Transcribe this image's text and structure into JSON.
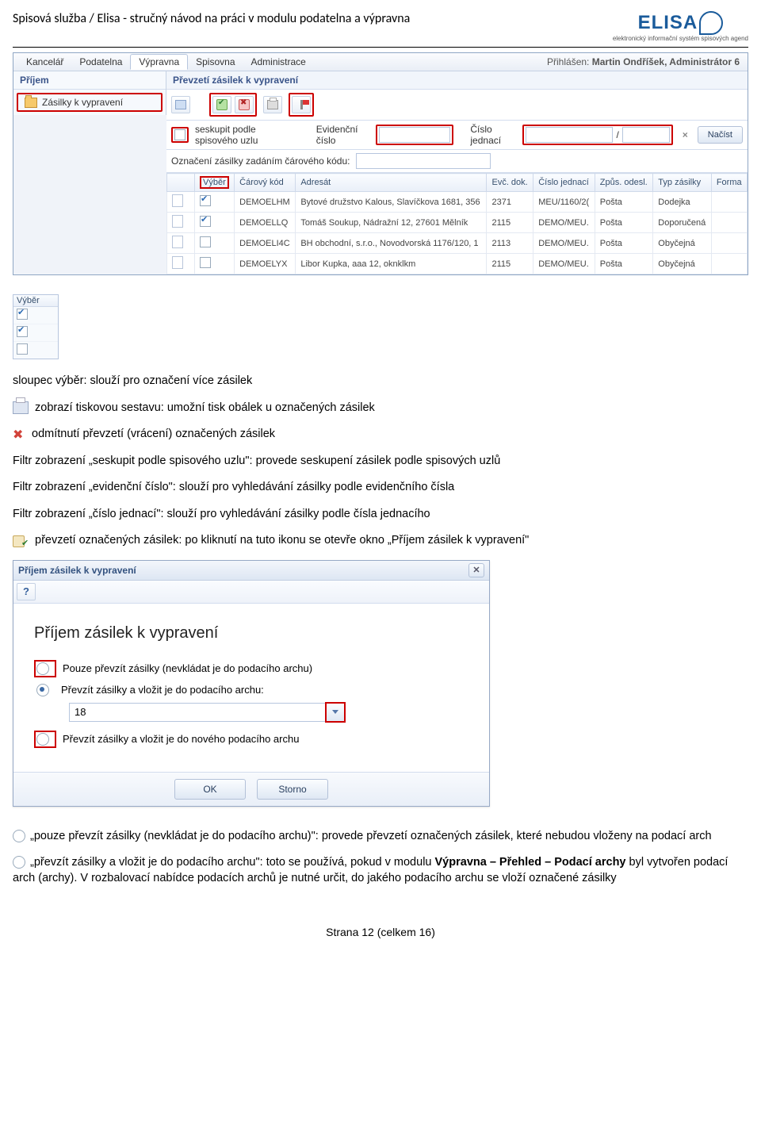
{
  "doc": {
    "title": "Spisová služba / Elisa - stručný návod na práci v modulu podatelna a výpravna",
    "page_footer": "Strana 12 (celkem 16)"
  },
  "logo": {
    "name": "ELISA",
    "tagline": "elektronický informační systém spisových agend"
  },
  "app": {
    "menu": {
      "kancelar": "Kancelář",
      "podatelna": "Podatelna",
      "vypravna": "Výpravna",
      "spisovna": "Spisovna",
      "admin": "Administrace"
    },
    "login_label": "Přihlášen:",
    "login_user": "Martin Ondříšek, Administrátor 6",
    "side_head": "Příjem",
    "side_item": "Zásilky k vypravení",
    "panel_title": "Převzetí zásilek k vypravení",
    "filters": {
      "group_label": "seskupit podle spisového uzlu",
      "ev_label": "Evidenční číslo",
      "cj_label": "Číslo jednací",
      "slash": "/",
      "load_btn": "Načíst"
    },
    "barcode_label": "Označení zásilky zadáním čárového kódu:",
    "columns": {
      "vyber": "Výběr",
      "carovy": "Čárový kód",
      "adresat": "Adresát",
      "evdok": "Evč. dok.",
      "cj": "Číslo jednací",
      "zpus": "Způs. odesl.",
      "typ": "Typ zásilky",
      "forma": "Forma"
    },
    "rows": [
      {
        "checked": true,
        "code": "DEMOELHM",
        "addr": "Bytové družstvo Kalous, Slavíčkova 1681, 356",
        "evdok": "2371",
        "cj": "MEU/1160/2(",
        "zpus": "Pošta",
        "typ": "Dodejka"
      },
      {
        "checked": true,
        "code": "DEMOELLQ",
        "addr": "Tomáš Soukup, Nádražní 12, 27601 Mělník",
        "evdok": "2115",
        "cj": "DEMO/MEU.",
        "zpus": "Pošta",
        "typ": "Doporučená"
      },
      {
        "checked": false,
        "code": "DEMOELI4C",
        "addr": "BH obchodní, s.r.o., Novodvorská 1176/120, 1",
        "evdok": "2113",
        "cj": "DEMO/MEU.",
        "zpus": "Pošta",
        "typ": "Obyčejná"
      },
      {
        "checked": false,
        "code": "DEMOELYX",
        "addr": "Libor Kupka, aaa 12, oknklkm",
        "evdok": "2115",
        "cj": "DEMO/MEU.",
        "zpus": "Pošta",
        "typ": "Obyčejná"
      }
    ]
  },
  "mini_vyber_head": "Výběr",
  "prose": {
    "p1": "sloupec výběr: slouží pro označení více zásilek",
    "p2": "zobrazí tiskovou sestavu: umožní tisk obálek u označených zásilek",
    "p3": "odmítnutí převzetí (vrácení) označených zásilek",
    "p4": "Filtr zobrazení „seskupit podle spisového uzlu\": provede seskupení zásilek podle spisových uzlů",
    "p5": "Filtr zobrazení „evidenční číslo\": slouží pro vyhledávání zásilky podle evidenčního čísla",
    "p6": "Filtr zobrazení „číslo jednací\": slouží pro vyhledávání zásilky podle čísla jednacího",
    "p7": "převzetí označených zásilek: po kliknutí na tuto ikonu se otevře okno „Příjem zásilek k vypravení\""
  },
  "dialog": {
    "titlebar": "Příjem zásilek k vypravení",
    "heading": "Příjem zásilek k vypravení",
    "opt1": "Pouze převzít zásilky (nevkládat je do podacího archu)",
    "opt2": "Převzít zásilky a vložit je do podacího archu:",
    "combo_value": "18",
    "opt3": "Převzít zásilky a vložit je do nového podacího archu",
    "ok": "OK",
    "cancel": "Storno"
  },
  "tail": {
    "t1": "„pouze převzít zásilky (nevkládat je do podacího archu)\": provede převzetí označených zásilek, které nebudou vloženy na podací arch",
    "t2a": "„převzít zásilky a vložit je do podacího archu\": toto se používá, pokud v modulu ",
    "t2b": "Výpravna – Přehled – Podací archy",
    "t2c": " byl vytvořen podací arch (archy). V rozbalovací nabídce podacích archů je nutné určit, do jakého podacího archu se vloží označené zásilky"
  }
}
